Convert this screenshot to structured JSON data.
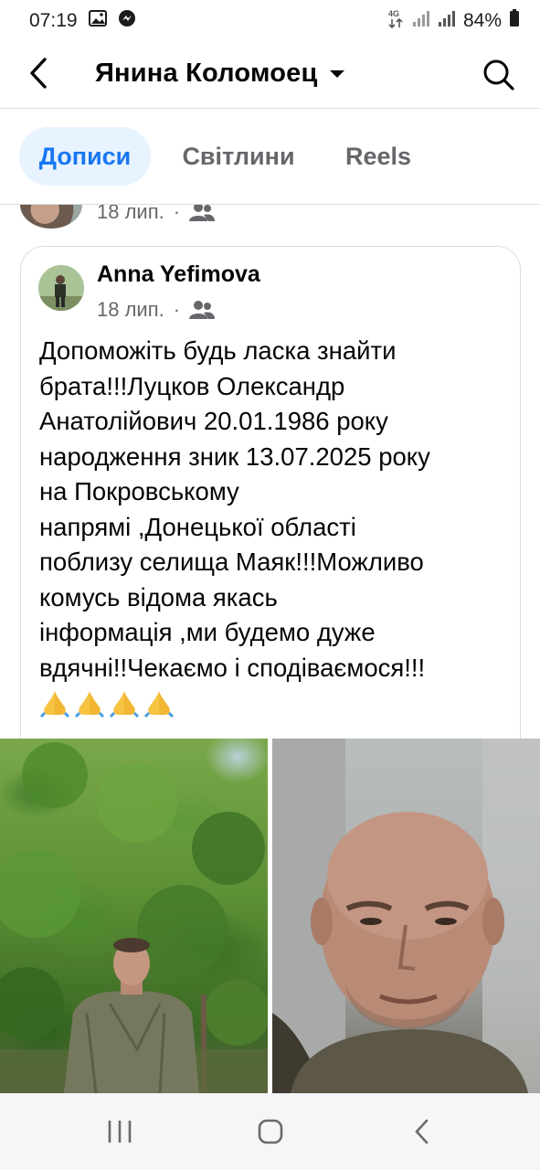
{
  "status_bar": {
    "time": "07:19",
    "network": "4G",
    "battery": "84%"
  },
  "header": {
    "title": "Янина Коломоец"
  },
  "tabs": [
    {
      "label": "Дописи",
      "active": true
    },
    {
      "label": "Світлини",
      "active": false
    },
    {
      "label": "Reels",
      "active": false
    }
  ],
  "prev_post": {
    "date": "18 лип.",
    "separator": "·"
  },
  "post": {
    "author": "Anna Yefimova",
    "date": "18 лип.",
    "separator": "·",
    "audience_icon": "friends-icon",
    "text_lines": [
      "Допоможіть будь ласка знайти",
      "брата!!!Луцков Олександр",
      "Анатолійович 20.01.1986 року",
      "народження зник 13.07.2025 року",
      "на Покровському",
      "напрямі ,Донецької області",
      "поблизу селища Маяк!!!Можливо",
      "комусь відома якась",
      "інформація ,ми будемо дуже",
      "вдячні!!Чекаємо і сподіваємося!!!"
    ],
    "emoji": [
      "🙏",
      "🙏",
      "🙏",
      "🙏"
    ]
  },
  "colors": {
    "accent": "#1877f2",
    "tab_active_bg": "#e7f3ff",
    "secondary_text": "#65676b",
    "divider": "#dadde1"
  }
}
